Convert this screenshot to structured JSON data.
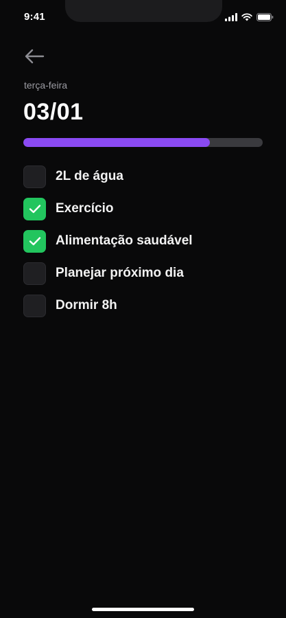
{
  "status_bar": {
    "time": "9:41",
    "icons": [
      "signal-icon",
      "wifi-icon",
      "battery-icon"
    ]
  },
  "header": {
    "back_icon": "arrow-left-icon",
    "weekday": "terça-feira",
    "date": "03/01"
  },
  "progress": {
    "fraction": 0.78,
    "fill_color": "#8a4af3",
    "track_color": "#3a3a3e"
  },
  "tasks": [
    {
      "label": "2L de água",
      "checked": false
    },
    {
      "label": "Exercício",
      "checked": true
    },
    {
      "label": "Alimentação saudável",
      "checked": true
    },
    {
      "label": "Planejar próximo dia",
      "checked": false
    },
    {
      "label": "Dormir 8h",
      "checked": false
    }
  ],
  "colors": {
    "background": "#09090a",
    "checked": "#22c55e",
    "unchecked": "#1f1f22"
  }
}
